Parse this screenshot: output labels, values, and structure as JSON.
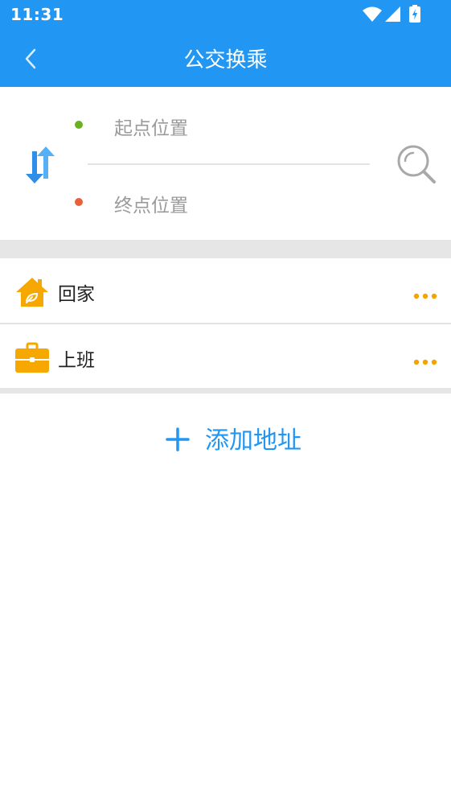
{
  "status_bar": {
    "time": "11:31",
    "icons": [
      "wifi-icon",
      "signal-icon",
      "battery-charging-icon"
    ]
  },
  "header": {
    "title": "公交换乘",
    "back_icon": "chevron-left-icon"
  },
  "route": {
    "start_placeholder": "起点位置",
    "end_placeholder": "终点位置",
    "start_dot_color": "#6ab023",
    "end_dot_color": "#e8603c"
  },
  "saved_places": [
    {
      "label": "回家",
      "icon": "home-icon",
      "more_icon": "more-dots-icon"
    },
    {
      "label": "上班",
      "icon": "briefcase-icon",
      "more_icon": "more-dots-icon"
    }
  ],
  "add_address": {
    "label": "添加地址",
    "icon": "plus-icon"
  },
  "colors": {
    "primary": "#2196f3",
    "accent": "#f5a300",
    "separator": "#e6e6e6"
  }
}
